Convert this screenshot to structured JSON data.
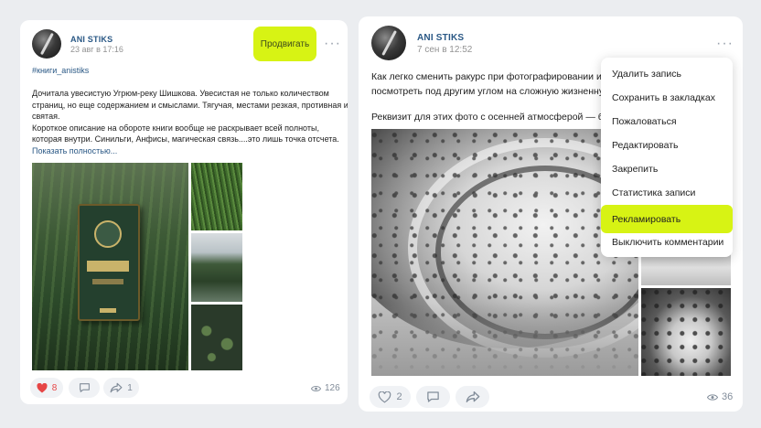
{
  "left_post": {
    "author": "ANI STIKS",
    "date": "23 авг в 17:16",
    "promote_label": "Продвигать",
    "hashtag": "#книги_anistiks",
    "text_lines": [
      "Дочитала увесистую Угрюм-реку Шишкова. Увесистая не только количеством",
      "страниц, но еще содержанием и смыслами. Тягучая, местами резкая, противная и",
      "святая.",
      "Короткое описание на обороте книги вообще не раскрывает всей полноты,",
      "которая внутри. Синильги, Анфисы, магическая связь....это лишь точка отсчета."
    ],
    "show_more": "Показать полностью...",
    "likes": "8",
    "reposts": "1",
    "views": "126"
  },
  "right_post": {
    "author": "ANI STIKS",
    "date": "7 сен в 12:52",
    "text_lines": [
      "Как легко сменить ракурс при фотографировании и к",
      "посмотреть под другим углом на сложную жизненну"
    ],
    "text_line3": "Реквизит для этих фото с осенней атмосферой — бок",
    "likes": "2",
    "views": "36"
  },
  "menu": {
    "items": [
      "Удалить запись",
      "Сохранить в закладках",
      "Пожаловаться",
      "Редактировать",
      "Закрепить",
      "Статистика записи",
      "Рекламировать",
      "Выключить комментарии"
    ],
    "highlighted_index": 6
  },
  "colors": {
    "accent": "#d7f314",
    "link": "#2a5885",
    "like_red": "#e64646"
  }
}
